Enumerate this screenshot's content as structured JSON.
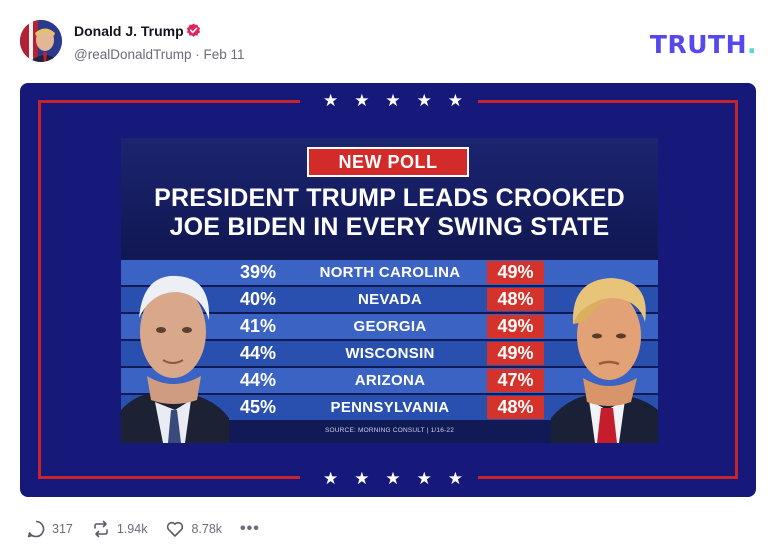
{
  "post": {
    "author": {
      "display_name": "Donald J. Trump",
      "handle": "@realDonaldTrump",
      "date": "Feb 11"
    },
    "brand": {
      "logo_text": "TRUTH",
      "logo_dot": ".",
      "accent": "#5448ee",
      "dot_color": "#57d9c3"
    }
  },
  "poll_image": {
    "badge": "NEW POLL",
    "headline_line1": "PRESIDENT TRUMP LEADS CROOKED",
    "headline_line2": "JOE BIDEN IN EVERY SWING STATE",
    "rows": [
      {
        "left": "39%",
        "state": "NORTH CAROLINA",
        "right": "49%"
      },
      {
        "left": "40%",
        "state": "NEVADA",
        "right": "48%"
      },
      {
        "left": "41%",
        "state": "GEORGIA",
        "right": "49%"
      },
      {
        "left": "44%",
        "state": "WISCONSIN",
        "right": "49%"
      },
      {
        "left": "44%",
        "state": "ARIZONA",
        "right": "47%"
      },
      {
        "left": "45%",
        "state": "PENNSYLVANIA",
        "right": "48%"
      }
    ],
    "source": "SOURCE: MORNING CONSULT | 1/16-22",
    "colors": {
      "card_bg": "#16197a",
      "frame_red": "#c4242c",
      "highlight_red": "#d6322c",
      "row_blue": "#3a63c4"
    }
  },
  "actions": {
    "replies": "317",
    "retruths": "1.94k",
    "likes": "8.78k",
    "more": "•••"
  }
}
